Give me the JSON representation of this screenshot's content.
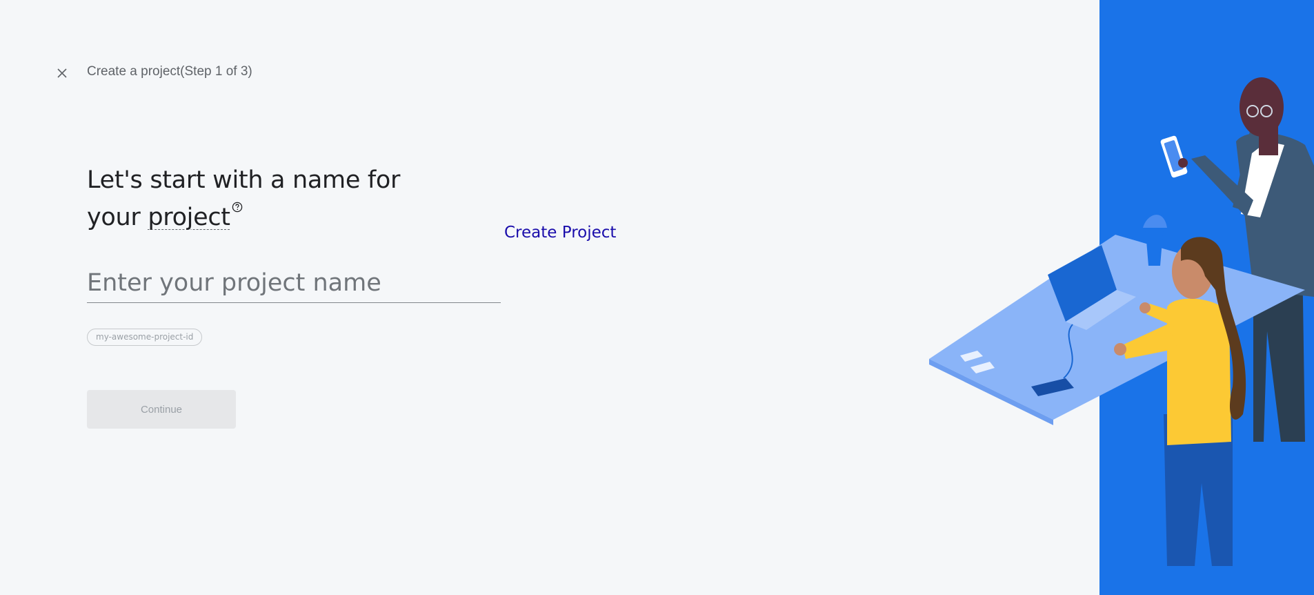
{
  "header": {
    "title": "Create a project(Step 1 of 3)",
    "close_icon": "close-icon"
  },
  "main": {
    "heading_prefix": "Let's start with a name for your ",
    "heading_term": "project",
    "help_icon": "help-icon",
    "create_link": "Create Project",
    "name_input": {
      "value": "",
      "placeholder": "Enter your project name"
    },
    "project_id": "my-awesome-project-id",
    "continue_label": "Continue"
  },
  "colors": {
    "background": "#f5f7f9",
    "illustration_blue": "#1a73e8",
    "link": "#1a0dab",
    "button_disabled_bg": "#e6e7e9"
  }
}
